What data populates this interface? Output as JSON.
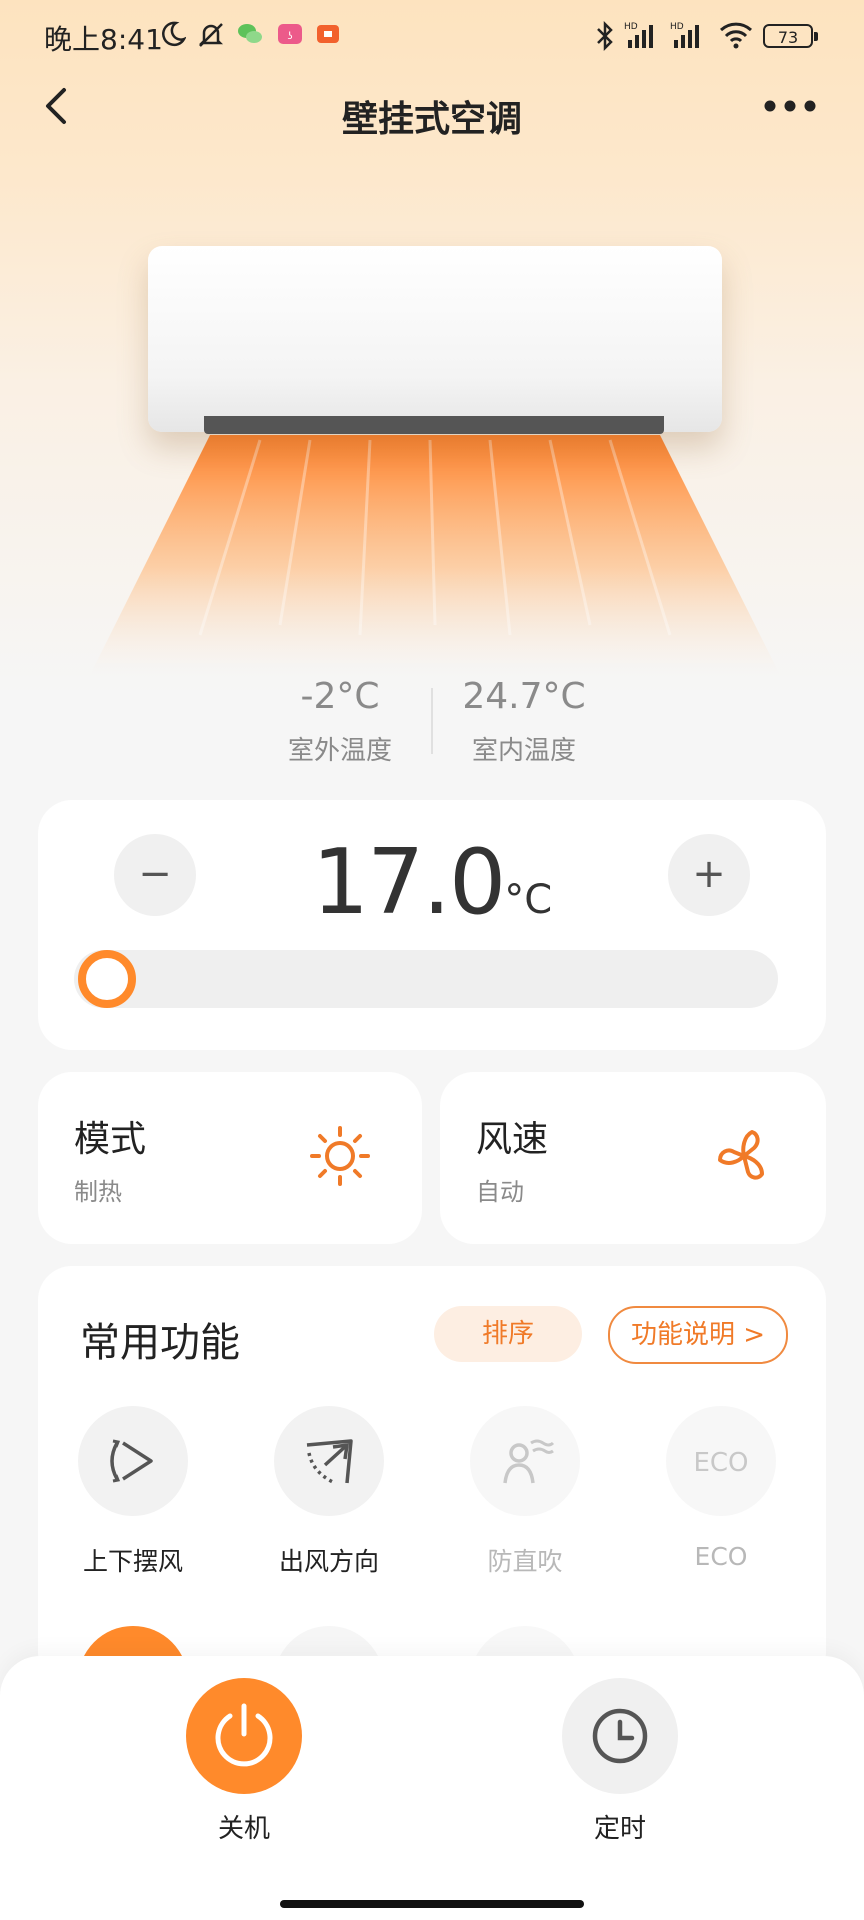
{
  "status_bar": {
    "time": "晚上8:41",
    "battery": "73",
    "icons": [
      "moon-icon",
      "mute-bell-icon",
      "wechat-icon",
      "app-icon",
      "video-app-icon",
      "bluetooth-icon",
      "signal-hd-icon",
      "signal-hd-icon",
      "wifi-icon"
    ]
  },
  "header": {
    "title": "壁挂式空调",
    "back_icon": "chevron-left-icon",
    "more_icon": "more-dots-icon"
  },
  "temps": {
    "outdoor_value": "-2°C",
    "outdoor_label": "室外温度",
    "indoor_value": "24.7°C",
    "indoor_label": "室内温度"
  },
  "temperature_control": {
    "minus_label": "−",
    "plus_label": "+",
    "value": "17.0",
    "unit": "°C",
    "slider_fraction": 0.0
  },
  "mode": {
    "title": "模式",
    "value": "制热",
    "icon": "sun-icon"
  },
  "fan_speed": {
    "title": "风速",
    "value": "自动",
    "icon": "fan-icon"
  },
  "functions": {
    "title": "常用功能",
    "sort_label": "排序",
    "help_label": "功能说明 >",
    "items": [
      {
        "label": "上下摆风",
        "icon": "swing-icon",
        "enabled": true
      },
      {
        "label": "出风方向",
        "icon": "air-direction-icon",
        "enabled": true
      },
      {
        "label": "防直吹",
        "icon": "anti-direct-blow-icon",
        "enabled": false
      },
      {
        "label": "ECO",
        "icon": "eco-icon",
        "enabled": false
      }
    ]
  },
  "bottom_bar": {
    "power_label": "关机",
    "timer_label": "定时"
  },
  "colors": {
    "accent": "#ff8a2b",
    "background": "#f6f6f6",
    "card": "#ffffff"
  }
}
